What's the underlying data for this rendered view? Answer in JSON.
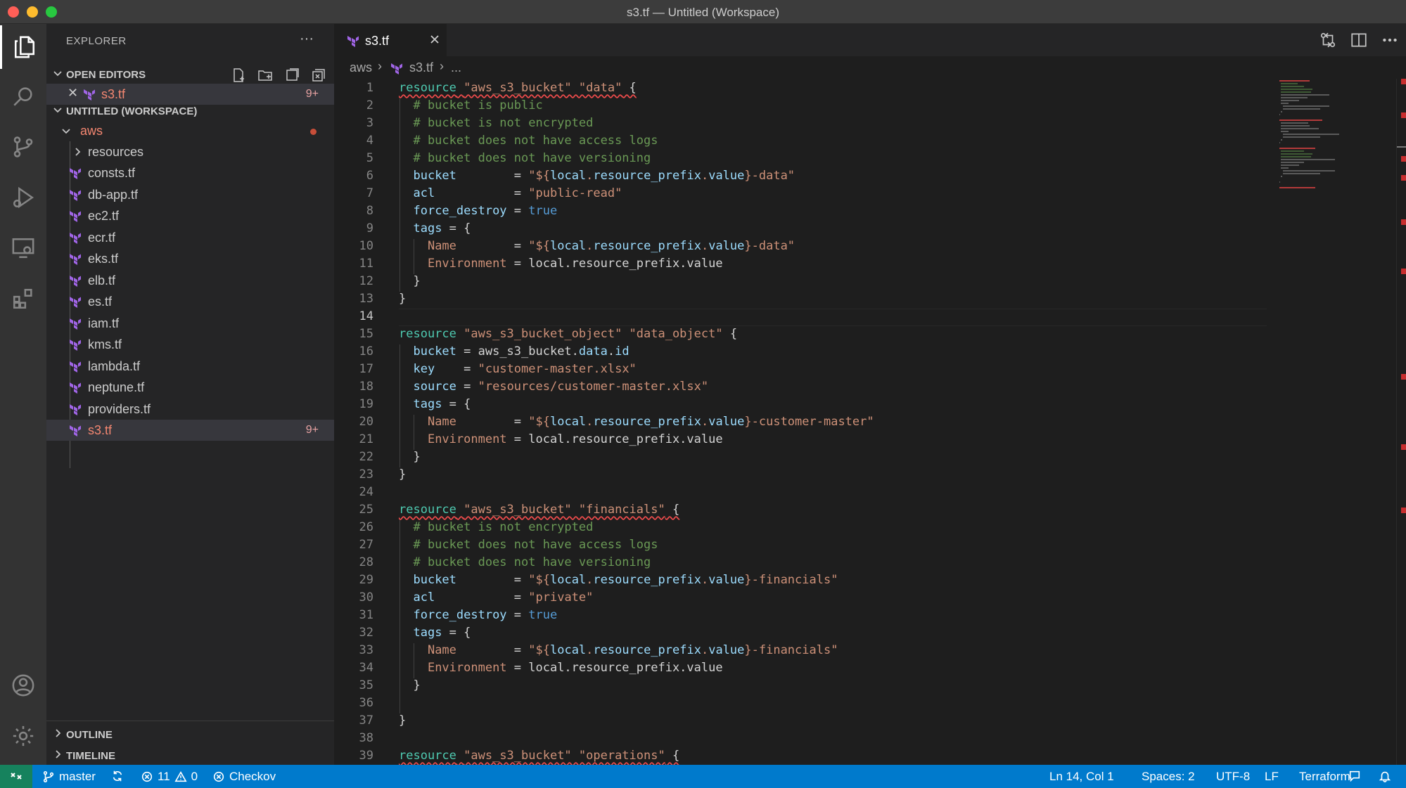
{
  "window": {
    "title": "s3.tf — Untitled (Workspace)"
  },
  "sidebar": {
    "header": "EXPLORER",
    "more": "···",
    "open_editors": {
      "label": "OPEN EDITORS",
      "items": [
        {
          "name": "s3.tf",
          "badge": "9+"
        }
      ]
    },
    "workspace": {
      "label": "UNTITLED (WORKSPACE)",
      "folder": "aws",
      "subfolder": "resources",
      "files": [
        {
          "name": "consts.tf"
        },
        {
          "name": "db-app.tf"
        },
        {
          "name": "ec2.tf"
        },
        {
          "name": "ecr.tf"
        },
        {
          "name": "eks.tf"
        },
        {
          "name": "elb.tf"
        },
        {
          "name": "es.tf"
        },
        {
          "name": "iam.tf"
        },
        {
          "name": "kms.tf"
        },
        {
          "name": "lambda.tf"
        },
        {
          "name": "neptune.tf"
        },
        {
          "name": "providers.tf"
        },
        {
          "name": "s3.tf",
          "badge": "9+"
        }
      ]
    },
    "outline_label": "OUTLINE",
    "timeline_label": "TIMELINE"
  },
  "tabs": [
    {
      "name": "s3.tf",
      "active": true
    }
  ],
  "breadcrumb": {
    "folder": "aws",
    "file": "s3.tf",
    "more": "..."
  },
  "editor": {
    "current_line": 14,
    "lines": [
      "resource \"aws_s3_bucket\" \"data\" {",
      "  # bucket is public",
      "  # bucket is not encrypted",
      "  # bucket does not have access logs",
      "  # bucket does not have versioning",
      "  bucket        = \"${local.resource_prefix.value}-data\"",
      "  acl           = \"public-read\"",
      "  force_destroy = true",
      "  tags = {",
      "    Name        = \"${local.resource_prefix.value}-data\"",
      "    Environment = local.resource_prefix.value",
      "  }",
      "}",
      "",
      "resource \"aws_s3_bucket_object\" \"data_object\" {",
      "  bucket = aws_s3_bucket.data.id",
      "  key    = \"customer-master.xlsx\"",
      "  source = \"resources/customer-master.xlsx\"",
      "  tags = {",
      "    Name        = \"${local.resource_prefix.value}-customer-master\"",
      "    Environment = local.resource_prefix.value",
      "  }",
      "}",
      "",
      "resource \"aws_s3_bucket\" \"financials\" {",
      "  # bucket is not encrypted",
      "  # bucket does not have access logs",
      "  # bucket does not have versioning",
      "  bucket        = \"${local.resource_prefix.value}-financials\"",
      "  acl           = \"private\"",
      "  force_destroy = true",
      "  tags = {",
      "    Name        = \"${local.resource_prefix.value}-financials\"",
      "    Environment = local.resource_prefix.value",
      "  }",
      "",
      "}",
      "",
      "resource \"aws_s3_bucket\" \"operations\" {"
    ]
  },
  "statusbar": {
    "branch": "master",
    "errors": "11",
    "warnings": "0",
    "checkov": "Checkov",
    "position": "Ln 14, Col 1",
    "spaces": "Spaces: 2",
    "encoding": "UTF-8",
    "eol": "LF",
    "language": "Terraform"
  },
  "colors": {
    "accent": "#007acc",
    "error": "#f48771",
    "keyword": "#4ec9b0",
    "string": "#ce9178",
    "comment": "#6a9955"
  }
}
